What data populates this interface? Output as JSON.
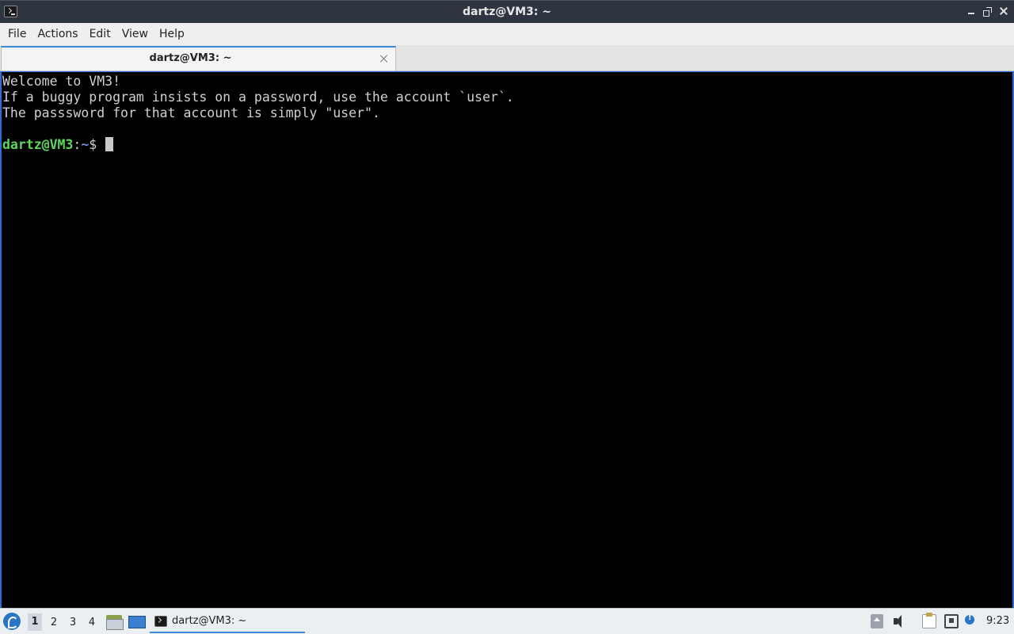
{
  "window": {
    "title": "dartz@VM3: ~",
    "app_icon": "terminal-icon"
  },
  "menubar": {
    "items": [
      "File",
      "Actions",
      "Edit",
      "View",
      "Help"
    ]
  },
  "tabs": [
    {
      "label": "dartz@VM3: ~",
      "active": true
    }
  ],
  "terminal": {
    "lines": [
      "Welcome to VM3!",
      "If a buggy program insists on a password, use the account `user`.",
      "The passsword for that account is simply \"user\".",
      ""
    ],
    "prompt": {
      "user_host": "dartz@VM3",
      "separator": ":",
      "path": "~",
      "symbol": "$ "
    },
    "colors": {
      "background": "#000000",
      "text": "#d0d0d0",
      "prompt_user": "#5fd75f",
      "prompt_path": "#6f8fd8"
    }
  },
  "taskbar": {
    "desktops": [
      "1",
      "2",
      "3",
      "4"
    ],
    "active_desktop": "1",
    "launchers": [
      "file-manager-icon",
      "show-desktop-icon"
    ],
    "tasks": [
      {
        "label": "dartz@VM3: ~",
        "icon": "terminal-icon"
      }
    ],
    "tray": [
      "eject-icon",
      "volume-icon",
      "clipboard-icon",
      "network-icon",
      "notification-icon"
    ],
    "clock": "9:23"
  }
}
